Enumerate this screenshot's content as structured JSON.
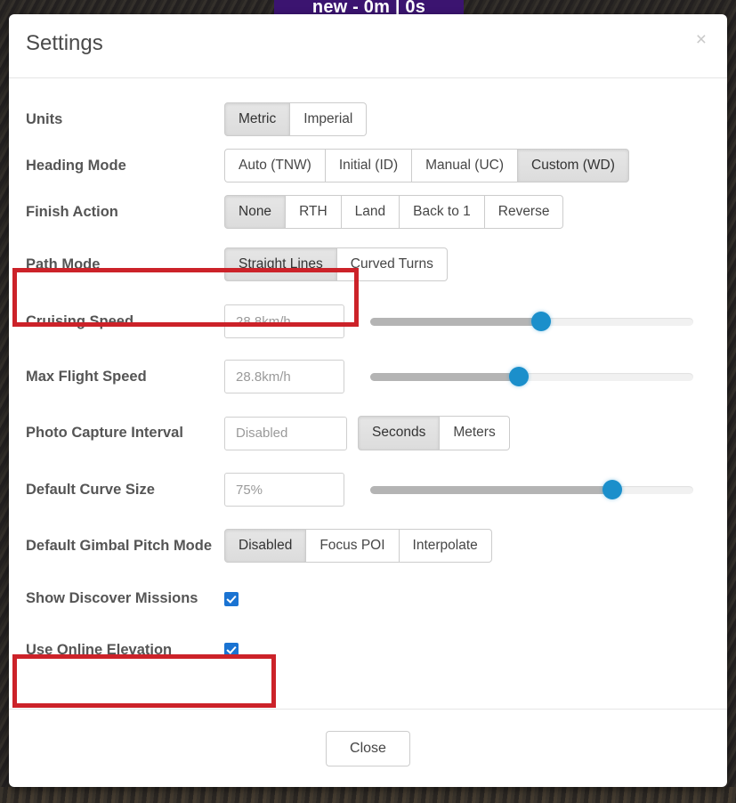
{
  "background": {
    "banner_title": "new - 0m | 0s"
  },
  "modal": {
    "title": "Settings",
    "close_icon": "close-icon",
    "close_icon_glyph": "×",
    "footer": {
      "close_label": "Close"
    }
  },
  "settings": {
    "units": {
      "label": "Units",
      "options": [
        "Metric",
        "Imperial"
      ],
      "selected": "Metric"
    },
    "heading_mode": {
      "label": "Heading Mode",
      "options": [
        "Auto (TNW)",
        "Initial (ID)",
        "Manual (UC)",
        "Custom (WD)"
      ],
      "selected": "Custom (WD)"
    },
    "finish_action": {
      "label": "Finish Action",
      "options": [
        "None",
        "RTH",
        "Land",
        "Back to 1",
        "Reverse"
      ],
      "selected": "None"
    },
    "path_mode": {
      "label": "Path Mode",
      "options": [
        "Straight Lines",
        "Curved Turns"
      ],
      "selected": "Straight Lines",
      "highlighted": true
    },
    "cruising_speed": {
      "label": "Cruising Speed",
      "value": "",
      "placeholder": "28.8km/h",
      "slider_percent": 53
    },
    "max_flight_speed": {
      "label": "Max Flight Speed",
      "value": "",
      "placeholder": "28.8km/h",
      "slider_percent": 46
    },
    "photo_capture_interval": {
      "label": "Photo Capture Interval",
      "value": "",
      "placeholder": "Disabled",
      "options": [
        "Seconds",
        "Meters"
      ],
      "selected": "Seconds"
    },
    "default_curve_size": {
      "label": "Default Curve Size",
      "value": "",
      "placeholder": "75%",
      "slider_percent": 75
    },
    "default_gimbal_pitch_mode": {
      "label": "Default Gimbal Pitch Mode",
      "options": [
        "Disabled",
        "Focus POI",
        "Interpolate"
      ],
      "selected": "Disabled"
    },
    "show_discover_missions": {
      "label": "Show Discover Missions",
      "checked": true
    },
    "use_online_elevation": {
      "label": "Use Online Elevation",
      "checked": true,
      "highlighted": true
    }
  },
  "colors": {
    "accent_blue": "#1b8fcb",
    "checkbox_blue": "#1a73d2",
    "highlight_red": "#cc2229",
    "active_segment_gray": "#e0e0e0"
  }
}
